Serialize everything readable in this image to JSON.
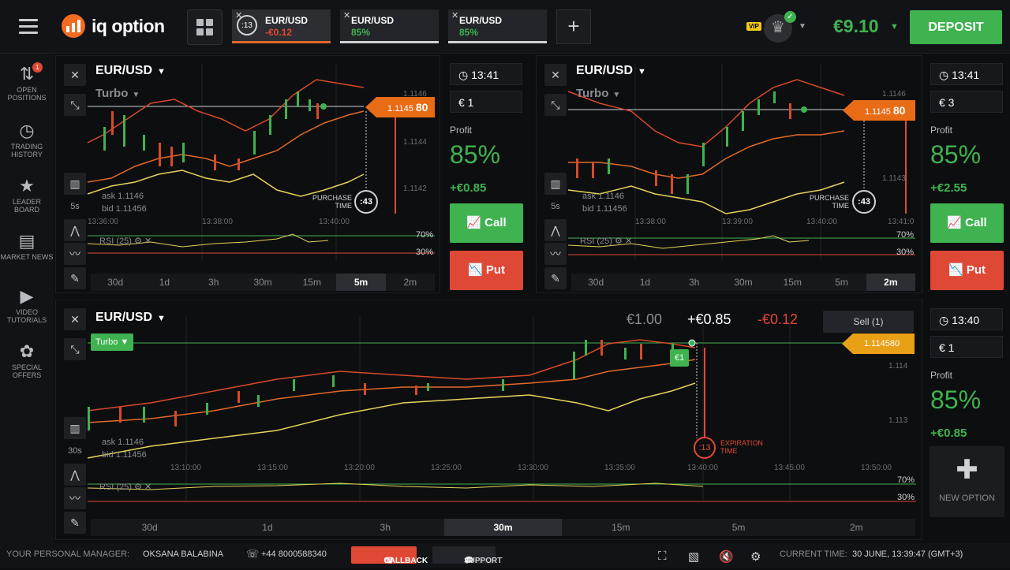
{
  "app": {
    "logo_text": "iq option",
    "balance": "€9.10",
    "deposit_label": "DEPOSIT",
    "vip_label": "VIP"
  },
  "tabs": [
    {
      "name": "EUR/USD",
      "value": "-€0.12",
      "timer": ":13",
      "value_color": "#e04836"
    },
    {
      "name": "EUR/USD",
      "value": "85%",
      "value_color": "#3fb34f"
    },
    {
      "name": "EUR/USD",
      "value": "85%",
      "value_color": "#3fb34f"
    }
  ],
  "sidebar": {
    "items": [
      {
        "label": "OPEN POSITIONS",
        "icon": "arrows-updown-icon",
        "badge": "1"
      },
      {
        "label": "TRADING HISTORY",
        "icon": "history-icon"
      },
      {
        "label": "LEADER BOARD",
        "icon": "leader-icon"
      },
      {
        "label": "MARKET NEWS",
        "icon": "news-icon"
      },
      {
        "label": "VIDEO TUTORIALS",
        "icon": "play-icon"
      },
      {
        "label": "SPECIAL OFFERS",
        "icon": "gift-icon"
      }
    ]
  },
  "charts": {
    "top_left": {
      "asset": "EUR/USD",
      "mode": "Turbo",
      "ask": "ask 1.1146",
      "bid": "bid 1.11456",
      "price": "1.1145",
      "price_big": "80",
      "y_labels": [
        "1.1146",
        "1.1144",
        "1.1142"
      ],
      "time_labels": [
        "13:36:00",
        "13:38:00",
        "13:40:00"
      ],
      "tool_label": "5s",
      "rsi": "RSI (25)",
      "lvl_high": "70%",
      "lvl_low": "30%",
      "purchase_label": "PURCHASE TIME",
      "purchase_timer": ":43",
      "timeframes": [
        "30d",
        "1d",
        "3h",
        "30m",
        "15m",
        "5m",
        "2m"
      ],
      "selected": 5
    },
    "top_right": {
      "asset": "EUR/USD",
      "mode": "Turbo",
      "ask": "ask 1.1146",
      "bid": "bid 1.11456",
      "price": "1.1145",
      "price_big": "80",
      "y_labels": [
        "1.1146",
        "1.1143"
      ],
      "time_labels": [
        "13:38:00",
        "13:39:00",
        "13:40:00",
        "13:41:0"
      ],
      "tool_label": "5s",
      "rsi": "RSI (25)",
      "lvl_high": "70%",
      "lvl_low": "30%",
      "purchase_label": "PURCHASE TIME",
      "purchase_timer": ":43",
      "timeframes": [
        "30d",
        "1d",
        "3h",
        "30m",
        "15m",
        "5m",
        "2m"
      ],
      "selected": 6
    },
    "bottom": {
      "asset": "EUR/USD",
      "mode": "Turbo",
      "ask": "ask 1.1146",
      "bid": "bid 1.11456",
      "price": "1.114580",
      "entry_tag": "€1",
      "y_labels": [
        "1.114",
        "1.113"
      ],
      "time_labels": [
        "13:10:00",
        "13:15:00",
        "13:20:00",
        "13:25:00",
        "13:30:00",
        "13:35:00",
        "13:40:00",
        "13:45:00",
        "13:50:00"
      ],
      "tool_label": "30s",
      "rsi": "RSI (25)",
      "lvl_high": "70%",
      "lvl_low": "30%",
      "invest": "€1.00",
      "gain": "+€0.85",
      "loss": "-€0.12",
      "sell_label": "Sell (1)",
      "expiration_label": "EXPIRATION TIME",
      "expiration_timer": ":13",
      "timeframes": [
        "30d",
        "1d",
        "3h",
        "30m",
        "15m",
        "5m",
        "2m"
      ],
      "selected": 3
    }
  },
  "trade": {
    "top_left": {
      "time": "13:41",
      "amount": "€ 1",
      "profit_label": "Profit",
      "profit": "85%",
      "gain": "+€0.85",
      "call": "Call",
      "put": "Put"
    },
    "top_right": {
      "time": "13:41",
      "amount": "€ 3",
      "profit_label": "Profit",
      "profit": "85%",
      "gain": "+€2.55",
      "call": "Call",
      "put": "Put"
    },
    "bottom": {
      "time": "13:40",
      "amount": "€ 1",
      "profit_label": "Profit",
      "profit": "85%",
      "gain": "+€0.85",
      "new_option": "NEW OPTION"
    }
  },
  "footer": {
    "manager_label": "YOUR PERSONAL MANAGER:",
    "manager_name": "OKSANA BALABINA",
    "phone": "+44 8000588340",
    "callback": "CALLBACK",
    "support": "SUPPORT",
    "time_label": "CURRENT TIME:",
    "time_value": "30 JUNE, 13:39:47 (GMT+3)"
  },
  "colors": {
    "green": "#3fb34f",
    "red": "#e04836",
    "orange": "#e86c16",
    "yellow": "#e5d35a"
  }
}
